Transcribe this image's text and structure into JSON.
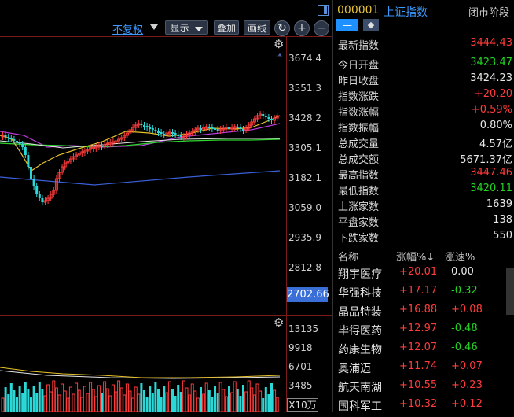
{
  "chart_toolbar": {
    "fuquan_label": "不复权",
    "display_label": "显示",
    "overlay_label": "叠加",
    "draw_label": "画线",
    "refresh_icon": "refresh-icon",
    "zoom_in_icon": "plus-icon",
    "zoom_out_icon": "minus-icon"
  },
  "price_axis": {
    "ticks": [
      "3674.4",
      "3551.3",
      "3428.2",
      "3305.1",
      "3182.1",
      "3059.0",
      "2935.9",
      "2812.8"
    ],
    "current_price_tag": "2702.66",
    "marker": "*"
  },
  "volume_axis": {
    "ticks": [
      "13135",
      "9918",
      "6701",
      "3485"
    ],
    "unit": "X10万"
  },
  "header": {
    "code": "000001",
    "name": "上证指数",
    "status": "闭市阶段",
    "minus_btn": "—",
    "accent": "#1e90ff"
  },
  "stats": [
    {
      "label": "最新指数",
      "value": "3444.43",
      "tone": "red"
    },
    {
      "label": "今日开盘",
      "value": "3423.47",
      "tone": "green"
    },
    {
      "label": "昨日收盘",
      "value": "3424.23",
      "tone": "white"
    },
    {
      "label": "指数涨跌",
      "value": "+20.20",
      "tone": "red"
    },
    {
      "label": "指数涨幅",
      "value": "+0.59%",
      "tone": "red"
    },
    {
      "label": "指数振幅",
      "value": "0.80%",
      "tone": "white"
    },
    {
      "label": "总成交量",
      "value": "4.57亿",
      "tone": "white"
    },
    {
      "label": "总成交额",
      "value": "5671.37亿",
      "tone": "white"
    },
    {
      "label": "最高指数",
      "value": "3447.46",
      "tone": "red"
    },
    {
      "label": "最低指数",
      "value": "3420.11",
      "tone": "green"
    },
    {
      "label": "上涨家数",
      "value": "1639",
      "tone": "white"
    },
    {
      "label": "平盘家数",
      "value": "138",
      "tone": "white"
    },
    {
      "label": "下跌家数",
      "value": "550",
      "tone": "white"
    }
  ],
  "rank_header": {
    "name": "名称",
    "change": "涨幅%↓",
    "speed": "涨速%"
  },
  "rank": [
    {
      "name": "翔宇医疗",
      "change": "+20.01",
      "speed": "0.00",
      "speed_tone": "white"
    },
    {
      "name": "华强科技",
      "change": "+17.17",
      "speed": "-0.32",
      "speed_tone": "green"
    },
    {
      "name": "晶品特装",
      "change": "+16.88",
      "speed": "+0.08",
      "speed_tone": "red"
    },
    {
      "name": "毕得医药",
      "change": "+12.97",
      "speed": "-0.48",
      "speed_tone": "green"
    },
    {
      "name": "药康生物",
      "change": "+12.07",
      "speed": "-0.46",
      "speed_tone": "green"
    },
    {
      "name": "奥浦迈",
      "change": "+11.74",
      "speed": "+0.07",
      "speed_tone": "red"
    },
    {
      "name": "航天南湖",
      "change": "+10.55",
      "speed": "+0.23",
      "speed_tone": "red"
    },
    {
      "name": "国科军工",
      "change": "+10.32",
      "speed": "+0.12",
      "speed_tone": "red"
    }
  ]
}
